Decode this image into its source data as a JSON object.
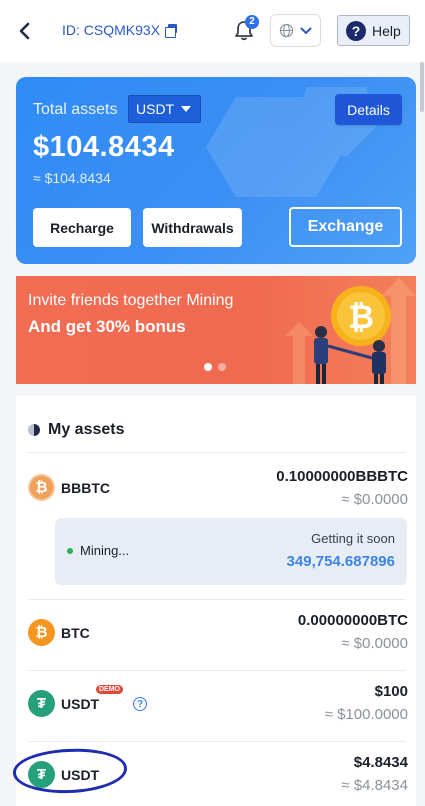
{
  "header": {
    "uid_label": "ID: CSQMK93X",
    "notification_count": "2",
    "help_label": "Help"
  },
  "summary": {
    "total_label": "Total assets",
    "currency": "USDT",
    "details_label": "Details",
    "total_value": "$104.8434",
    "approx_value": "≈ $104.8434",
    "recharge_label": "Recharge",
    "withdraw_label": "Withdrawals",
    "exchange_label": "Exchange"
  },
  "banner": {
    "line1": "Invite friends together Mining",
    "line2": "And get 30% bonus"
  },
  "assets": {
    "title": "My assets",
    "bbbtc": {
      "name": "BBBTC",
      "amount": "0.10000000BBBTC",
      "fiat": "≈ $0.0000",
      "mining_status": "Mining...",
      "mining_soon": "Getting it soon",
      "mining_value": "349,754.687896"
    },
    "btc": {
      "name": "BTC",
      "amount": "0.00000000BTC",
      "fiat": "≈ $0.0000"
    },
    "usdt_demo": {
      "name": "USDT",
      "badge": "DEMO",
      "amount": "$100",
      "fiat": "≈ $100.0000"
    },
    "usdt": {
      "name": "USDT",
      "amount": "$4.8434",
      "fiat": "≈ $4.8434"
    }
  },
  "colors": {
    "accent_blue": "#2f8cf5",
    "banner_orange": "#f26c54",
    "mining_value_blue": "#3c85e6"
  }
}
